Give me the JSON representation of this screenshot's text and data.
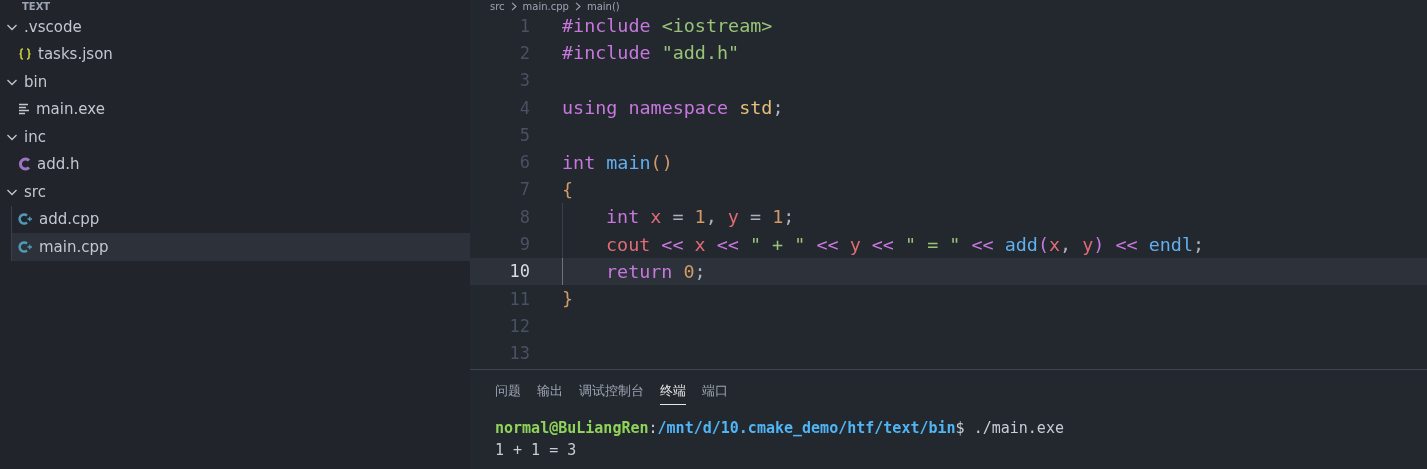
{
  "explorer": {
    "title": "TEXT",
    "tree": [
      {
        "name": ".vscode",
        "kind": "folder",
        "expanded": true,
        "children": [
          {
            "name": "tasks.json",
            "kind": "json",
            "selected": false
          }
        ]
      },
      {
        "name": "bin",
        "kind": "folder",
        "expanded": true,
        "children": [
          {
            "name": "main.exe",
            "kind": "text",
            "selected": false
          }
        ]
      },
      {
        "name": "inc",
        "kind": "folder",
        "expanded": true,
        "children": [
          {
            "name": "add.h",
            "kind": "c",
            "selected": false
          }
        ]
      },
      {
        "name": "src",
        "kind": "folder",
        "expanded": true,
        "children": [
          {
            "name": "add.cpp",
            "kind": "cpp",
            "selected": false
          },
          {
            "name": "main.cpp",
            "kind": "cpp",
            "selected": true
          }
        ]
      }
    ]
  },
  "breadcrumb": [
    "src",
    "main.cpp",
    "main()"
  ],
  "editor": {
    "lines": [
      {
        "number": "1",
        "current": false,
        "indented": false,
        "tokens": [
          {
            "kind": "keyword",
            "text": "#include "
          },
          {
            "kind": "string",
            "text": "<iostream>"
          }
        ]
      },
      {
        "number": "2",
        "current": false,
        "indented": false,
        "tokens": [
          {
            "kind": "keyword",
            "text": "#include "
          },
          {
            "kind": "string",
            "text": "\"add.h\""
          }
        ]
      },
      {
        "number": "3",
        "current": false,
        "indented": false
      },
      {
        "number": "4",
        "current": false,
        "indented": false,
        "tokens": [
          {
            "kind": "keyword",
            "text": "using namespace "
          },
          {
            "kind": "namespace",
            "text": "std"
          },
          {
            "kind": "plain",
            "text": ";"
          }
        ]
      },
      {
        "number": "5",
        "current": false,
        "indented": false
      },
      {
        "number": "6",
        "current": false,
        "indented": false,
        "tokens": [
          {
            "kind": "keyword",
            "text": "int "
          },
          {
            "kind": "function",
            "text": "main"
          },
          {
            "kind": "paren",
            "text": "()"
          }
        ]
      },
      {
        "number": "7",
        "current": false,
        "indented": false,
        "tokens": [
          {
            "kind": "paren",
            "text": "{"
          }
        ]
      },
      {
        "number": "8",
        "current": false,
        "indented": true,
        "tokens": [
          {
            "kind": "keyword",
            "text": "int "
          },
          {
            "kind": "variable",
            "text": "x"
          },
          {
            "kind": "plain",
            "text": " = "
          },
          {
            "kind": "number",
            "text": "1"
          },
          {
            "kind": "plain",
            "text": ", "
          },
          {
            "kind": "variable",
            "text": "y"
          },
          {
            "kind": "plain",
            "text": " = "
          },
          {
            "kind": "number",
            "text": "1"
          },
          {
            "kind": "plain",
            "text": ";"
          }
        ]
      },
      {
        "number": "9",
        "current": false,
        "indented": true,
        "tokens": [
          {
            "kind": "variable",
            "text": "cout"
          },
          {
            "kind": "operator",
            "text": " << "
          },
          {
            "kind": "variable",
            "text": "x"
          },
          {
            "kind": "operator",
            "text": " << "
          },
          {
            "kind": "string",
            "text": "\" + \""
          },
          {
            "kind": "operator",
            "text": " << "
          },
          {
            "kind": "variable",
            "text": "y"
          },
          {
            "kind": "operator",
            "text": " << "
          },
          {
            "kind": "string",
            "text": "\" = \""
          },
          {
            "kind": "operator",
            "text": " << "
          },
          {
            "kind": "function",
            "text": "add"
          },
          {
            "kind": "bracket",
            "text": "("
          },
          {
            "kind": "variable",
            "text": "x"
          },
          {
            "kind": "plain",
            "text": ", "
          },
          {
            "kind": "variable",
            "text": "y"
          },
          {
            "kind": "bracket",
            "text": ")"
          },
          {
            "kind": "operator",
            "text": " << "
          },
          {
            "kind": "function",
            "text": "endl"
          },
          {
            "kind": "plain",
            "text": ";"
          }
        ]
      },
      {
        "number": "10",
        "current": true,
        "indented": true,
        "tokens": [
          {
            "kind": "keyword",
            "text": "return "
          },
          {
            "kind": "number",
            "text": "0"
          },
          {
            "kind": "plain",
            "text": ";"
          }
        ]
      },
      {
        "number": "11",
        "current": false,
        "indented": false,
        "tokens": [
          {
            "kind": "paren",
            "text": "}"
          }
        ]
      },
      {
        "number": "12",
        "current": false,
        "indented": false
      },
      {
        "number": "13",
        "current": false,
        "indented": false
      }
    ]
  },
  "panel": {
    "tabs": [
      {
        "label": "问题",
        "selected": false
      },
      {
        "label": "输出",
        "selected": false
      },
      {
        "label": "调试控制台",
        "selected": false
      },
      {
        "label": "终端",
        "selected": true
      },
      {
        "label": "端口",
        "selected": false
      }
    ],
    "terminal": [
      [
        {
          "kind": "user",
          "text": "normal@BuLiangRen"
        },
        {
          "kind": "plain",
          "text": ":"
        },
        {
          "kind": "path",
          "text": "/mnt/d/10.cmake_demo/htf/text/bin"
        },
        {
          "kind": "plain",
          "text": "$ ./main.exe"
        }
      ],
      [
        {
          "kind": "plain",
          "text": "1 + 1 = 3"
        }
      ]
    ]
  }
}
